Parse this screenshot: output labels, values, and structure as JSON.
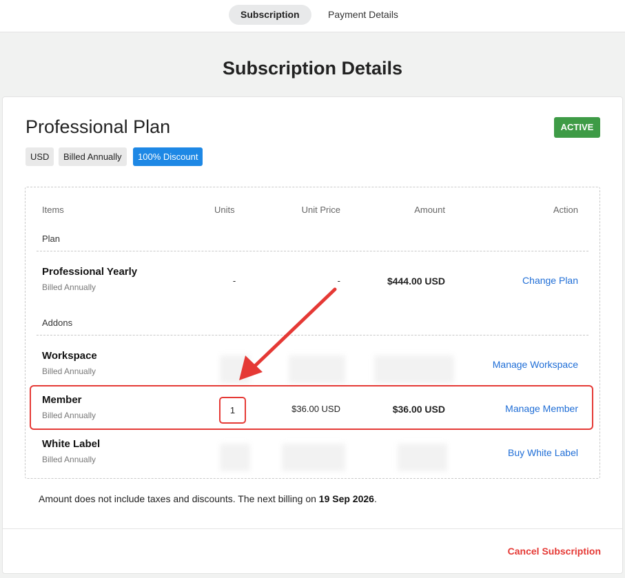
{
  "nav": {
    "tabs": [
      {
        "label": "Subscription",
        "active": true
      },
      {
        "label": "Payment Details",
        "active": false
      }
    ]
  },
  "page_title": "Subscription Details",
  "plan": {
    "title": "Professional Plan",
    "status": "ACTIVE",
    "chips": {
      "currency": "USD",
      "billing": "Billed Annually",
      "discount": "100% Discount"
    }
  },
  "table": {
    "headers": {
      "items": "Items",
      "units": "Units",
      "unit_price": "Unit Price",
      "amount": "Amount",
      "action": "Action"
    },
    "sections": {
      "plan": "Plan",
      "addons": "Addons"
    },
    "plan_row": {
      "name": "Professional Yearly",
      "billing": "Billed Annually",
      "units": "-",
      "unit_price": "-",
      "amount": "$444.00 USD",
      "action": "Change Plan"
    },
    "addons": [
      {
        "name": "Workspace",
        "billing": "Billed Annually",
        "units": "",
        "unit_price": "",
        "amount": "",
        "action": "Manage Workspace"
      },
      {
        "name": "Member",
        "billing": "Billed Annually",
        "units": "1",
        "unit_price": "$36.00 USD",
        "amount": "$36.00 USD",
        "action": "Manage Member"
      },
      {
        "name": "White Label",
        "billing": "Billed Annually",
        "units": "",
        "unit_price": "",
        "amount": "",
        "action": "Buy White Label"
      }
    ]
  },
  "note": {
    "text": "Amount does not include taxes and discounts. The next billing on ",
    "date": "19 Sep 2026",
    "suffix": "."
  },
  "cancel_label": "Cancel Subscription",
  "colors": {
    "accent_blue": "#1e88e5",
    "link": "#1e6dd6",
    "active_green": "#3e9b46",
    "danger_red": "#e53935"
  }
}
